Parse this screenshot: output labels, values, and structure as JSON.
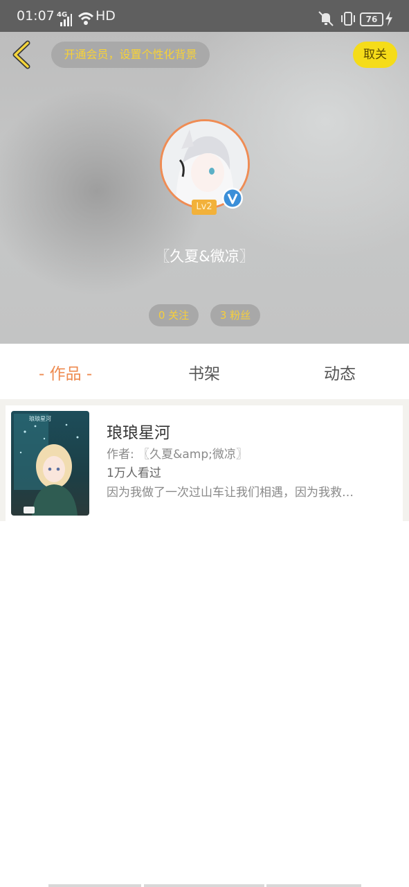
{
  "status_bar": {
    "time": "01:07",
    "network": "4G",
    "hd": "HD",
    "battery": "76"
  },
  "header": {
    "vip_prompt": "开通会员，设置个性化背景",
    "cancel_label": "取关",
    "level": "Lv2",
    "username": "〖久夏&微凉〗",
    "following": "0 关注",
    "followers": "3 粉丝"
  },
  "tabs": [
    {
      "label": "- 作品 -",
      "active": true
    },
    {
      "label": "书架",
      "active": false
    },
    {
      "label": "动态",
      "active": false
    }
  ],
  "works": [
    {
      "cover_text": "琅琅星河",
      "title": "琅琅星河",
      "author": "作者: 〖久夏&amp;微凉〗",
      "views": "1万人看过",
      "description": "因为我做了一次过山车让我们相遇，因为我救…"
    }
  ],
  "colors": {
    "accent_orange": "#ee8a4f",
    "vip_yellow": "#f8d236",
    "cancel_yellow": "#f5dc19",
    "verified_blue": "#3b8fd8"
  },
  "icons": [
    "back-arrow-icon",
    "verified-icon",
    "signal-icon",
    "wifi-icon",
    "mute-icon",
    "vibrate-icon",
    "charging-icon"
  ]
}
